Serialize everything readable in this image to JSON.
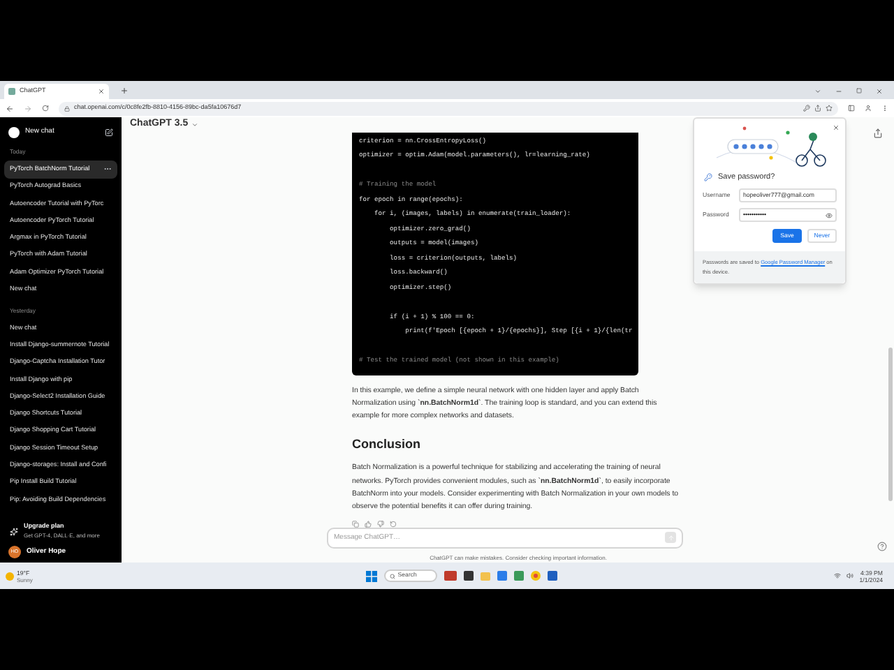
{
  "browser": {
    "tab_title": "ChatGPT",
    "url": "chat.openai.com/c/0c8fe2fb-8810-4156-89bc-da5fa10676d7"
  },
  "sidebar": {
    "new_chat": "New chat",
    "sections": [
      {
        "label": "Today",
        "items": [
          {
            "title": "PyTorch BatchNorm Tutorial",
            "selected": true
          },
          {
            "title": "PyTorch Autograd Basics",
            "selected": false
          },
          {
            "title": "Autoencoder Tutorial with PyTorc",
            "selected": false
          },
          {
            "title": "Autoencoder PyTorch Tutorial",
            "selected": false
          },
          {
            "title": "Argmax in PyTorch Tutorial",
            "selected": false
          },
          {
            "title": "PyTorch with Adam Tutorial",
            "selected": false
          },
          {
            "title": "Adam Optimizer PyTorch Tutorial",
            "selected": false
          },
          {
            "title": "New chat",
            "selected": false
          }
        ]
      },
      {
        "label": "Yesterday",
        "items": [
          {
            "title": "New chat",
            "selected": false
          },
          {
            "title": "Install Django-summernote Tutorial",
            "selected": false
          },
          {
            "title": "Django-Captcha Installation Tutor",
            "selected": false
          },
          {
            "title": "Install Django with pip",
            "selected": false
          },
          {
            "title": "Django-Select2 Installation Guide",
            "selected": false
          },
          {
            "title": "Django Shortcuts Tutorial",
            "selected": false
          },
          {
            "title": "Django Shopping Cart Tutorial",
            "selected": false
          },
          {
            "title": "Django Session Timeout Setup",
            "selected": false
          },
          {
            "title": "Django-storages: Install and Confi",
            "selected": false
          },
          {
            "title": "Pip Install Build Tutorial",
            "selected": false
          },
          {
            "title": "Pip: Avoiding Build Dependencies",
            "selected": false
          }
        ]
      }
    ],
    "upgrade": {
      "title": "Upgrade plan",
      "subtitle": "Get GPT-4, DALL·E, and more"
    },
    "user": {
      "initials": "HO",
      "name": "Oliver Hope"
    }
  },
  "header": {
    "model": "ChatGPT 3.5"
  },
  "code_lines": [
    {
      "kind": "code",
      "text": "criterion = nn.CrossEntropyLoss()"
    },
    {
      "kind": "code",
      "text": "optimizer = optim.Adam(model.parameters(), lr=learning_rate)"
    },
    {
      "kind": "blank"
    },
    {
      "kind": "comment",
      "text": "# Training the model"
    },
    {
      "kind": "code",
      "text": "for epoch in range(epochs):"
    },
    {
      "kind": "code",
      "text": "    for i, (images, labels) in enumerate(train_loader):"
    },
    {
      "kind": "code",
      "text": "        optimizer.zero_grad()"
    },
    {
      "kind": "code",
      "text": "        outputs = model(images)"
    },
    {
      "kind": "code",
      "text": "        loss = criterion(outputs, labels)"
    },
    {
      "kind": "code",
      "text": "        loss.backward()"
    },
    {
      "kind": "code",
      "text": "        optimizer.step()"
    },
    {
      "kind": "blank"
    },
    {
      "kind": "code",
      "text": "        if (i + 1) % 100 == 0:"
    },
    {
      "kind": "code",
      "text": "            print(f'Epoch [{epoch + 1}/{epochs}], Step [{i + 1}/{len(tr"
    },
    {
      "kind": "blank"
    },
    {
      "kind": "comment",
      "text": "# Test the trained model (not shown in this example)"
    }
  ],
  "message": [
    {
      "kind": "paragraph",
      "text": "In this example, we define a simple neural network with one hidden layer and apply Batch Normalization using `**nn.BatchNorm1d**`. The training loop is standard, and you can extend this example for more complex networks and datasets."
    },
    {
      "kind": "heading",
      "text": "Conclusion"
    },
    {
      "kind": "paragraph",
      "text": "Batch Normalization is a powerful technique for stabilizing and accelerating the training of neural networks. PyTorch provides convenient modules, such as `**nn.BatchNorm1d**`, to easily incorporate BatchNorm into your models. Consider experimenting with Batch Normalization in your own models to observe the potential benefits it can offer during training."
    }
  ],
  "composer": {
    "placeholder": "Message ChatGPT…",
    "disclaimer": "ChatGPT can make mistakes. Consider checking important information."
  },
  "password_popup": {
    "title": "Save password?",
    "username_label": "Username",
    "username": "hopeoliver777@gmail.com",
    "password_label": "Password",
    "password": "•••••••••••",
    "save": "Save",
    "never": "Never",
    "footer_before": "Passwords are saved to",
    "footer_link": "Google Password Manager",
    "footer_after": "on this device."
  },
  "taskbar": {
    "temperature": "19°F",
    "weather": "Sunny",
    "search": "Search",
    "time": "4:39 PM",
    "date": "1/1/2024"
  }
}
